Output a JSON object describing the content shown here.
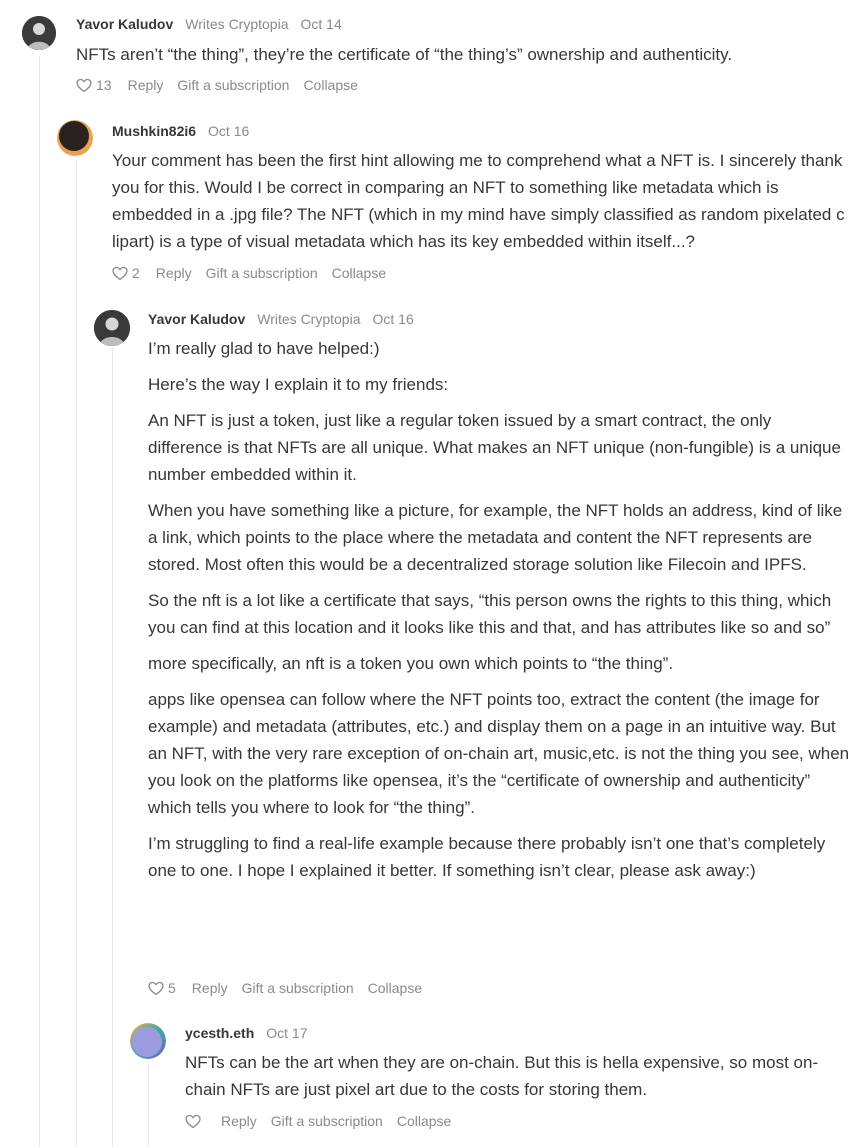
{
  "comments": [
    {
      "author": "Yavor Kaludov",
      "meta": "Writes Cryptopia",
      "date": "Oct 14",
      "paragraphs": [
        "NFTs aren’t “the thing”, they’re the certificate of “the thing’s” ownership and authenticity."
      ],
      "likes": "13",
      "reply": "Reply",
      "gift": "Gift a subscription",
      "collapse": "Collapse",
      "avatar_icon": "person-avatar"
    },
    {
      "author": "Mushkin82i6",
      "date": "Oct 16",
      "paragraphs": [
        "Your comment has been the first hint allowing me to comprehend what a NFT is. I sincerely thank you for this. Would I be correct in comparing an NFT to something like metadata which is embedded in a .jpg file? The NFT (which in my mind have simply classified as random pixelated c lipart) is a type of visual metadata which has its key embedded within itself...?"
      ],
      "likes": "2",
      "reply": "Reply",
      "gift": "Gift a subscription",
      "collapse": "Collapse",
      "avatar_icon": "dark-orange-avatar"
    },
    {
      "author": "Yavor Kaludov",
      "meta": "Writes Cryptopia",
      "date": "Oct 16",
      "paragraphs": [
        "I’m really glad to have helped:)",
        "Here’s the way I explain it to my friends:",
        "An NFT is just a token, just like a regular token issued by a smart contract, the only difference is that NFTs are all unique. What makes an NFT unique (non-fungible) is a unique number embedded within it.",
        "When you have something like a picture, for example, the NFT holds an address, kind of like a link, which points to the place where the metadata and content the NFT represents are stored. Most often this would be a decentralized storage solution like Filecoin and IPFS.",
        "So the nft is a lot like a certificate that says, “this person owns the rights to this thing, which you can find at this location and it looks like this and that, and has attributes like so and so”",
        "more specifically, an nft is a token you own which points to “the thing”.",
        "apps like opensea can follow where the NFT points too, extract the content (the image for example) and metadata (attributes, etc.) and display them on a page in an intuitive way. But an NFT, with the very rare exception of on-chain art, music,etc. is not the thing you see, when you look on the platforms like opensea, it’s the “certificate of ownership and authenticity” which tells you where to look for “the thing”.",
        "I’m struggling to find a real-life example because there probably isn’t one that’s completely one to one. I hope I explained it better. If something isn’t clear, please ask away:)"
      ],
      "likes": "5",
      "reply": "Reply",
      "gift": "Gift a subscription",
      "collapse": "Collapse",
      "avatar_icon": "person-avatar"
    },
    {
      "author": "ycesth.eth",
      "date": "Oct 17",
      "paragraphs": [
        "NFTs can be the art when they are on-chain. But this is hella expensive, so most on-chain NFTs are just pixel art due to the costs for storing them."
      ],
      "likes": "",
      "reply": "Reply",
      "gift": "Gift a subscription",
      "collapse": "Collapse",
      "avatar_icon": "purple-gradient-avatar"
    }
  ]
}
